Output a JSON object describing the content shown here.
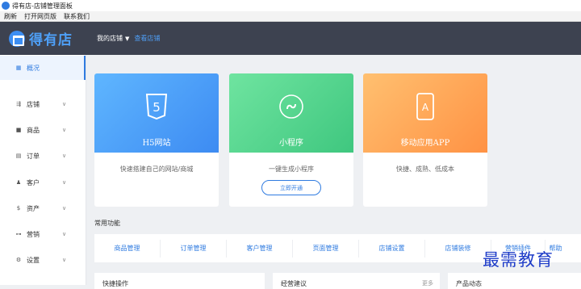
{
  "window": {
    "title": "得有店-店铺管理面板"
  },
  "menu": [
    {
      "label": "刷新"
    },
    {
      "label": "打开网页版"
    },
    {
      "label": "联系我们"
    }
  ],
  "header": {
    "logo_text": "得有店",
    "shop_selector": "我的店铺",
    "shop_link": "查看店铺"
  },
  "sidebar": {
    "items": [
      {
        "label": "概况",
        "icon": "grid-icon",
        "active": true
      },
      {
        "label": "店铺",
        "icon": "store-icon"
      },
      {
        "label": "商品",
        "icon": "goods-icon"
      },
      {
        "label": "订单",
        "icon": "order-icon"
      },
      {
        "label": "客户",
        "icon": "user-icon"
      },
      {
        "label": "资产",
        "icon": "dollar-icon"
      },
      {
        "label": "营销",
        "icon": "marketing-icon"
      },
      {
        "label": "设置",
        "icon": "settings-icon"
      }
    ]
  },
  "cards": [
    {
      "title": "H5网站",
      "description": "快速搭建自己的网站/商城",
      "icon_text": "5",
      "color": "#3d8bf2"
    },
    {
      "title": "小程序",
      "description": "一键生成小程序",
      "button": "立即开通",
      "color": "#3fc77f"
    },
    {
      "title": "移动应用APP",
      "description": "快捷、成熟、低成本",
      "icon_text": "A",
      "color": "#ff9244"
    }
  ],
  "common_functions": {
    "title": "常用功能",
    "items": [
      "商品管理",
      "订单管理",
      "客户管理",
      "页面管理",
      "店铺设置",
      "店铺装修",
      "营销插件",
      "帮助"
    ]
  },
  "bottom": {
    "quick_ops": "快捷操作",
    "suggestions": "经营建议",
    "more": "更多",
    "product_news": "产品动态"
  },
  "watermark": "最需教育",
  "colors": {
    "accent": "#2f7be0",
    "header_bg": "#3d4250"
  }
}
